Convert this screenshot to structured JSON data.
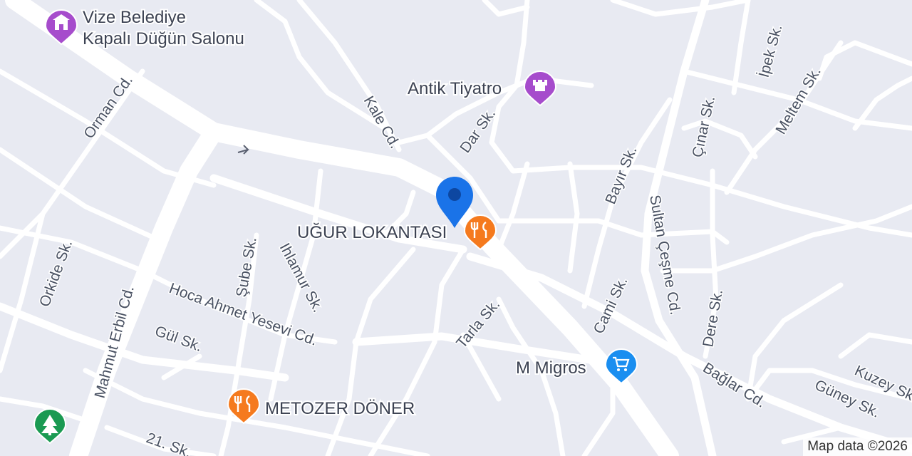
{
  "map": {
    "attribution": "Map data ©2026",
    "colors": {
      "background": "#e8eaf2",
      "road": "#ffffff",
      "text": "#4a5263",
      "poi_purple": "#a64ccc",
      "poi_orange": "#f57a1e",
      "poi_blue": "#1a8ef0",
      "poi_green": "#1a9a52",
      "location_pin": "#1a73e8"
    },
    "pois": [
      {
        "name": "Vize Belediye",
        "name2": "Kapalı Düğün Salonu",
        "icon": "building-icon",
        "color": "purple"
      },
      {
        "name": "Antik Tiyatro",
        "icon": "castle-icon",
        "color": "purple"
      },
      {
        "name": "UĞUR LOKANTASI",
        "icon": "fork-knife-icon",
        "color": "orange"
      },
      {
        "name": "M Migros",
        "icon": "shopping-cart-icon",
        "color": "blue"
      },
      {
        "name": "METOZER DÖNER",
        "icon": "fork-knife-icon",
        "color": "orange"
      },
      {
        "name": "",
        "icon": "tree-icon",
        "color": "green"
      }
    ],
    "streets": [
      "Orman Cd.",
      "Kale Cd.",
      "Dar Sk.",
      "İpek Sk.",
      "Meltem Sk.",
      "Çınar Sk.",
      "Bayır Sk.",
      "Sultan Çeşme Cd.",
      "Orkide Sk.",
      "Şube Sk.",
      "Ihlamur Sk.",
      "Mahmut Erbil Cd.",
      "Hoca Ahmet Yesevi Cd.",
      "Gül Sk.",
      "Tarla Sk.",
      "Cami Sk.",
      "Dere Sk.",
      "Bağlar Cd.",
      "Güney Sk.",
      "Kuzey Sk.",
      "21. Sk."
    ]
  }
}
